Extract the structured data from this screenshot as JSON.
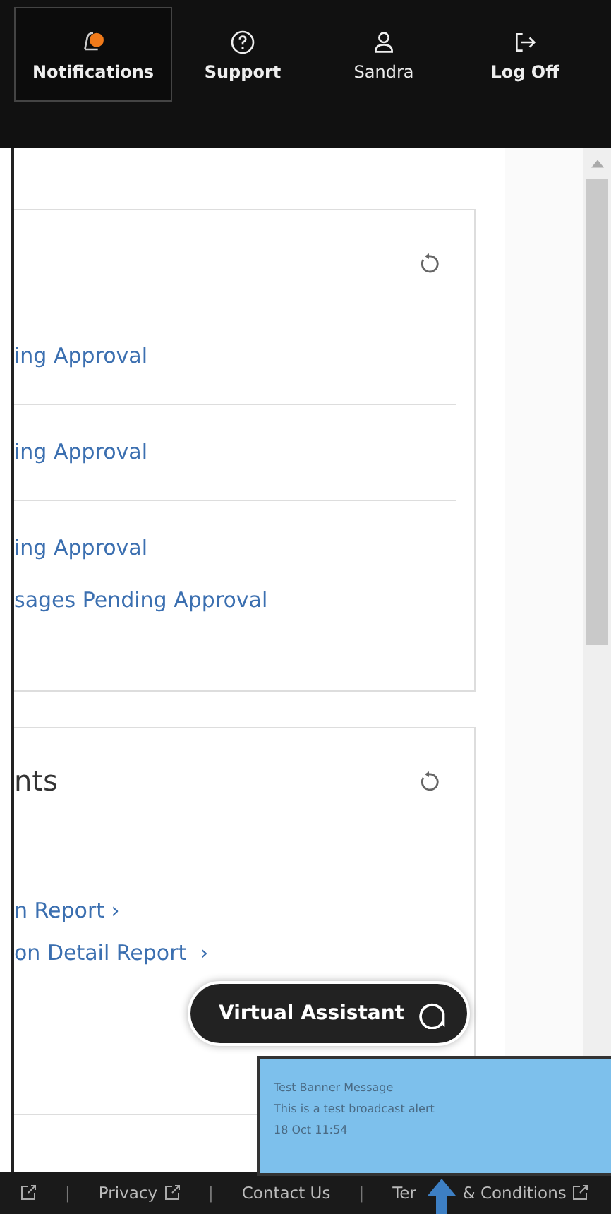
{
  "nav": [
    {
      "label": "Notifications",
      "kind": "bell",
      "selected": true
    },
    {
      "label": "Support",
      "kind": "help",
      "selected": false
    },
    {
      "label": "Sandra",
      "kind": "user",
      "selected": false
    },
    {
      "label": "Log Off",
      "kind": "logout",
      "selected": false
    }
  ],
  "cards": [
    {
      "groups": [
        {
          "links": [
            "ing Approval"
          ]
        },
        {
          "links": [
            "ing Approval"
          ]
        },
        {
          "links": [
            "ing Approval",
            "sages Pending Approval"
          ]
        }
      ]
    },
    {
      "title": "nts",
      "groups": [
        {
          "links": [
            "n Report ›",
            "on Detail Report  ›"
          ]
        }
      ]
    }
  ],
  "assistant": {
    "label": "Virtual Assistant"
  },
  "banner": {
    "title": "Test Banner Message",
    "message": "This is a test broadcast alert",
    "time": "18 Oct 11:54"
  },
  "footer": [
    {
      "kind": "icon"
    },
    {
      "kind": "sep",
      "text": "|"
    },
    {
      "kind": "link",
      "text": "Privacy",
      "external": true
    },
    {
      "kind": "sep",
      "text": "|"
    },
    {
      "kind": "link",
      "text": "Contact Us",
      "external": false
    },
    {
      "kind": "sep",
      "text": "|"
    },
    {
      "kind": "link",
      "text": "Ter         & Conditions",
      "external": true
    }
  ]
}
